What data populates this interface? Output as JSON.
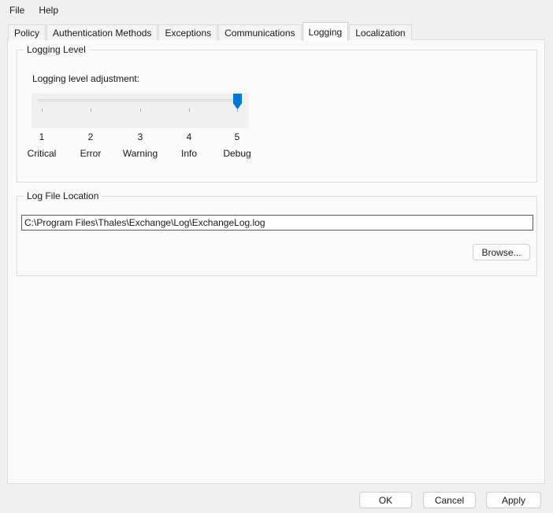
{
  "window": {
    "colors": {
      "dialog_bg": "#f0f0f0",
      "page_bg": "#fafafa",
      "accent": "#0078d7"
    }
  },
  "menu": {
    "items": [
      "File",
      "Help"
    ]
  },
  "tabs": {
    "selected": "Logging",
    "items": [
      {
        "label": "Policy"
      },
      {
        "label": "Authentication Methods"
      },
      {
        "label": "Exceptions"
      },
      {
        "label": "Communications"
      },
      {
        "label": "Logging"
      },
      {
        "label": "Localization"
      }
    ]
  },
  "logging_level": {
    "group_title": "Logging Level",
    "slider_label": "Logging level adjustment:",
    "slider": {
      "min": 1,
      "max": 5,
      "value": 5
    },
    "levels": [
      {
        "number": "1",
        "name": "Critical"
      },
      {
        "number": "2",
        "name": "Error"
      },
      {
        "number": "3",
        "name": "Warning"
      },
      {
        "number": "4",
        "name": "Info"
      },
      {
        "number": "5",
        "name": "Debug"
      }
    ]
  },
  "log_file": {
    "group_title": "Log File Location",
    "path_value": "C:\\Program Files\\Thales\\Exchange\\Log\\ExchangeLog.log",
    "browse_label": "Browse..."
  },
  "footer": {
    "ok_label": "OK",
    "cancel_label": "Cancel",
    "apply_label": "Apply"
  }
}
